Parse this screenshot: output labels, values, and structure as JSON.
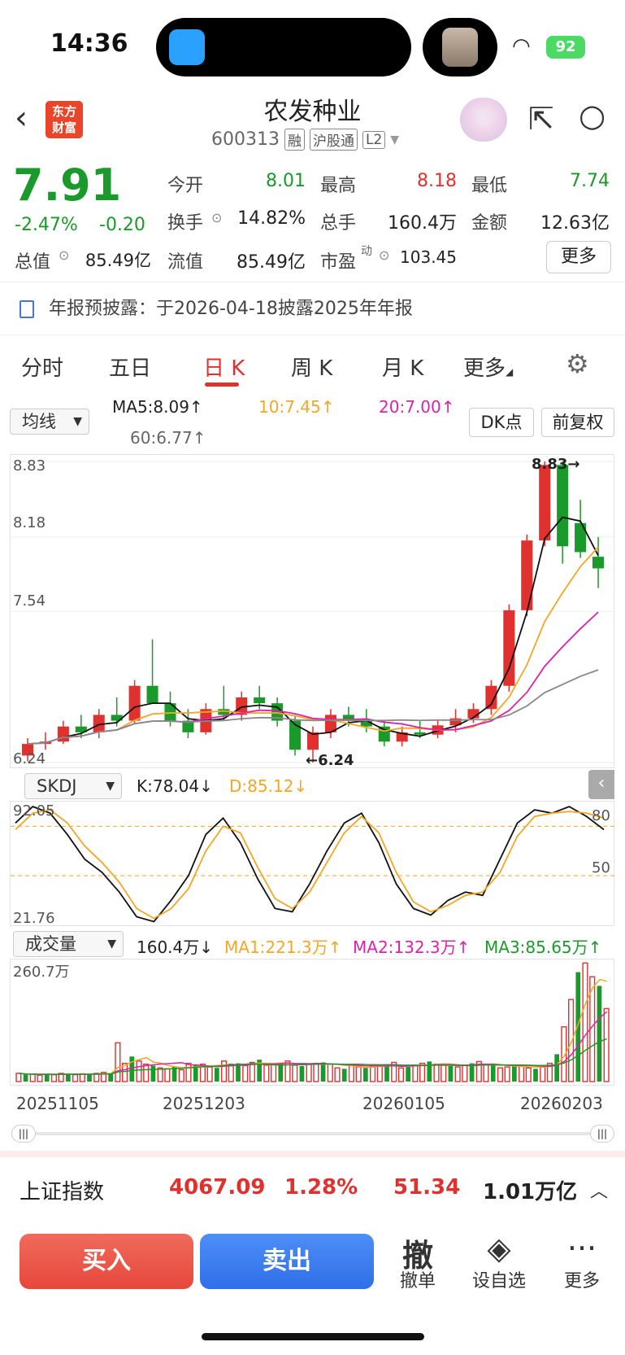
{
  "status_bar": {
    "time": "14:36",
    "battery": "92",
    "icons": [
      "qq-app-icon",
      "wifi-icon",
      "battery-icon"
    ]
  },
  "header": {
    "logo_line1": "东方",
    "logo_line2": "财富",
    "title": "农发种业",
    "code": "600313",
    "tags": [
      "融",
      "沪股通",
      "L2"
    ]
  },
  "quote": {
    "price": "7.91",
    "change_pct": "-2.47%",
    "change": "-0.20",
    "fields": [
      {
        "label": "今开",
        "value": "8.01",
        "color": "green"
      },
      {
        "label": "最高",
        "value": "8.18",
        "color": "red"
      },
      {
        "label": "最低",
        "value": "7.74",
        "color": "green"
      },
      {
        "label": "换手",
        "value": "14.82%",
        "color": "black"
      },
      {
        "label": "总手",
        "value": "160.4万",
        "color": "black"
      },
      {
        "label": "金额",
        "value": "12.63亿",
        "color": "black"
      },
      {
        "label": "总值",
        "value": "85.49亿",
        "color": "black"
      },
      {
        "label": "流值",
        "value": "85.49亿",
        "color": "black"
      },
      {
        "label": "市盈",
        "label_sup": "动",
        "value": "103.45",
        "color": "black"
      }
    ],
    "more": "更多"
  },
  "notice": "年报预披露：于2026-04-18披露2025年年报",
  "tabs": [
    "分时",
    "五日",
    "日 K",
    "周 K",
    "月 K",
    "更多"
  ],
  "active_tab": "日 K",
  "ma_controls": {
    "selector": "均线",
    "ma5": "MA5:8.09↑",
    "ma10": "10:7.45↑",
    "ma20": "20:7.00↑",
    "ma60": "60:6.77↑",
    "dk_button": "DK点",
    "fq_button": "前复权"
  },
  "kline": {
    "y_labels": [
      "8.83",
      "8.18",
      "7.54",
      "6.24"
    ],
    "high_marker": "8.83→",
    "low_marker": "←6.24"
  },
  "skdj": {
    "selector": "SKDJ",
    "k": "K:78.04↓",
    "d": "D:85.12↓",
    "y_labels": [
      "92.05",
      "80",
      "50",
      "21.76"
    ]
  },
  "volume": {
    "selector": "成交量",
    "vol": "160.4万↓",
    "ma1": "MA1:221.3万↑",
    "ma2": "MA2:132.3万↑",
    "ma3": "MA3:85.65万↑",
    "y_label": "260.7万",
    "x_labels": [
      "20251105",
      "20251203",
      "20260105",
      "20260203"
    ]
  },
  "index_bar": {
    "name": "上证指数",
    "value": "4067.09",
    "pct": "1.28%",
    "change": "51.34",
    "amount": "1.01万亿"
  },
  "actions": {
    "buy": "买入",
    "sell": "卖出",
    "cancel_icon": "撤",
    "cancel": "撤单",
    "watch": "设自选",
    "more": "更多"
  },
  "colors": {
    "up": "#e0312f",
    "down": "#1a9a2a",
    "accent": "#e0312f",
    "buy": "#ee5a4c",
    "sell": "#3f7ef0"
  },
  "chart_data": [
    {
      "type": "candlestick",
      "title": "",
      "ylim": [
        6.24,
        8.83
      ],
      "x_range": [
        "20251105",
        "20260209"
      ],
      "ohlc_sample": [
        {
          "o": 6.3,
          "h": 6.45,
          "l": 6.25,
          "c": 6.4
        },
        {
          "o": 6.4,
          "h": 6.5,
          "l": 6.35,
          "c": 6.42
        },
        {
          "o": 6.42,
          "h": 6.6,
          "l": 6.4,
          "c": 6.55
        },
        {
          "o": 6.55,
          "h": 6.65,
          "l": 6.45,
          "c": 6.5
        },
        {
          "o": 6.5,
          "h": 6.7,
          "l": 6.45,
          "c": 6.65
        },
        {
          "o": 6.65,
          "h": 6.8,
          "l": 6.55,
          "c": 6.6
        },
        {
          "o": 6.6,
          "h": 6.95,
          "l": 6.58,
          "c": 6.9
        },
        {
          "o": 6.9,
          "h": 7.3,
          "l": 6.85,
          "c": 6.75
        },
        {
          "o": 6.75,
          "h": 6.85,
          "l": 6.55,
          "c": 6.6
        },
        {
          "o": 6.6,
          "h": 6.7,
          "l": 6.45,
          "c": 6.5
        },
        {
          "o": 6.5,
          "h": 6.75,
          "l": 6.48,
          "c": 6.7
        },
        {
          "o": 6.7,
          "h": 6.9,
          "l": 6.6,
          "c": 6.65
        },
        {
          "o": 6.65,
          "h": 6.85,
          "l": 6.6,
          "c": 6.8
        },
        {
          "o": 6.8,
          "h": 6.9,
          "l": 6.7,
          "c": 6.75
        },
        {
          "o": 6.75,
          "h": 6.8,
          "l": 6.55,
          "c": 6.6
        },
        {
          "o": 6.6,
          "h": 6.65,
          "l": 6.3,
          "c": 6.35
        },
        {
          "o": 6.35,
          "h": 6.55,
          "l": 6.24,
          "c": 6.5
        },
        {
          "o": 6.5,
          "h": 6.7,
          "l": 6.45,
          "c": 6.65
        },
        {
          "o": 6.65,
          "h": 6.72,
          "l": 6.55,
          "c": 6.6
        },
        {
          "o": 6.6,
          "h": 6.7,
          "l": 6.5,
          "c": 6.55
        },
        {
          "o": 6.55,
          "h": 6.6,
          "l": 6.38,
          "c": 6.42
        },
        {
          "o": 6.42,
          "h": 6.55,
          "l": 6.38,
          "c": 6.5
        },
        {
          "o": 6.5,
          "h": 6.6,
          "l": 6.45,
          "c": 6.48
        },
        {
          "o": 6.48,
          "h": 6.6,
          "l": 6.45,
          "c": 6.56
        },
        {
          "o": 6.56,
          "h": 6.7,
          "l": 6.5,
          "c": 6.62
        },
        {
          "o": 6.62,
          "h": 6.75,
          "l": 6.58,
          "c": 6.7
        },
        {
          "o": 6.7,
          "h": 6.95,
          "l": 6.65,
          "c": 6.9
        },
        {
          "o": 6.9,
          "h": 7.6,
          "l": 6.85,
          "c": 7.55
        },
        {
          "o": 7.55,
          "h": 8.2,
          "l": 7.5,
          "c": 8.15
        },
        {
          "o": 8.15,
          "h": 8.83,
          "l": 8.1,
          "c": 8.8
        },
        {
          "o": 8.8,
          "h": 8.83,
          "l": 7.95,
          "c": 8.1
        },
        {
          "o": 8.3,
          "h": 8.5,
          "l": 8.0,
          "c": 8.05
        },
        {
          "o": 8.01,
          "h": 8.18,
          "l": 7.74,
          "c": 7.91
        }
      ]
    },
    {
      "type": "line",
      "title": "SKDJ",
      "ylim": [
        21.76,
        92.05
      ],
      "series": [
        {
          "name": "K",
          "values": [
            82,
            92,
            88,
            75,
            60,
            52,
            40,
            25,
            22,
            35,
            50,
            75,
            85,
            70,
            48,
            30,
            28,
            45,
            65,
            82,
            88,
            70,
            45,
            30,
            26,
            35,
            40,
            38,
            60,
            82,
            90,
            88,
            92,
            86,
            78
          ]
        },
        {
          "name": "D",
          "values": [
            78,
            88,
            90,
            82,
            68,
            58,
            46,
            30,
            24,
            30,
            42,
            65,
            80,
            76,
            55,
            36,
            30,
            40,
            58,
            76,
            86,
            76,
            52,
            34,
            28,
            32,
            38,
            40,
            52,
            74,
            86,
            88,
            89,
            88,
            85
          ]
        }
      ]
    },
    {
      "type": "bar",
      "title": "成交量",
      "ylim": [
        0,
        260.7
      ],
      "values": [
        18,
        15,
        16,
        14,
        17,
        15,
        18,
        16,
        15,
        17,
        16,
        18,
        20,
        17,
        85,
        40,
        55,
        45,
        38,
        35,
        30,
        28,
        32,
        26,
        40,
        36,
        38,
        32,
        30,
        45,
        38,
        40,
        35,
        42,
        48,
        36,
        38,
        40,
        45,
        36,
        34,
        38,
        40,
        42,
        38,
        30,
        28,
        35,
        32,
        30,
        34,
        36,
        38,
        42,
        30,
        32,
        36,
        40,
        44,
        38,
        36,
        34,
        32,
        36,
        40,
        44,
        38,
        35,
        30,
        32,
        34,
        36,
        30,
        28,
        32,
        40,
        60,
        120,
        180,
        240,
        260,
        230,
        210,
        160
      ]
    }
  ]
}
